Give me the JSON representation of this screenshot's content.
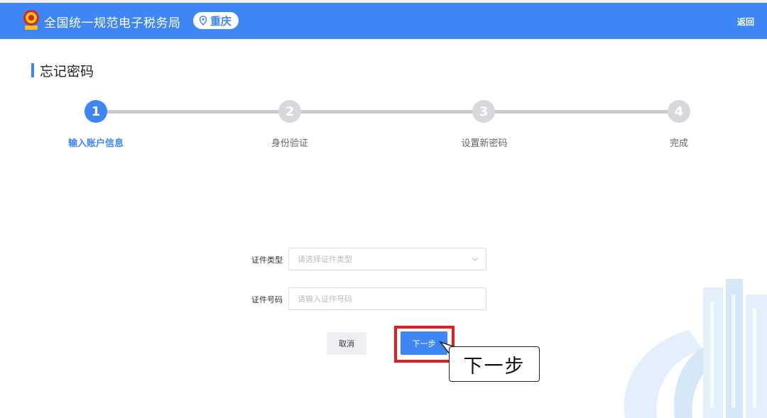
{
  "header": {
    "brand": "全国统一规范电子税务局",
    "city": "重庆",
    "back_label": "返回",
    "emblem_icon": "tax-emblem-icon",
    "pin_icon": "location-pin-icon"
  },
  "page": {
    "title": "忘记密码"
  },
  "steps": [
    {
      "number": "1",
      "label": "输入账户信息",
      "active": true
    },
    {
      "number": "2",
      "label": "身份验证",
      "active": false
    },
    {
      "number": "3",
      "label": "设置新密码",
      "active": false
    },
    {
      "number": "4",
      "label": "完成",
      "active": false
    }
  ],
  "form": {
    "id_type_label": "证件类型",
    "id_type_placeholder": "请选择证件类型",
    "id_number_label": "证件号码",
    "id_number_placeholder": "请输入证件号码"
  },
  "buttons": {
    "cancel": "取消",
    "next": "下一步"
  },
  "annotation": {
    "callout_text": "下一步"
  },
  "colors": {
    "primary": "#3e86f5",
    "highlight": "#e51d1d",
    "inactive_step": "#d6d8dc"
  }
}
